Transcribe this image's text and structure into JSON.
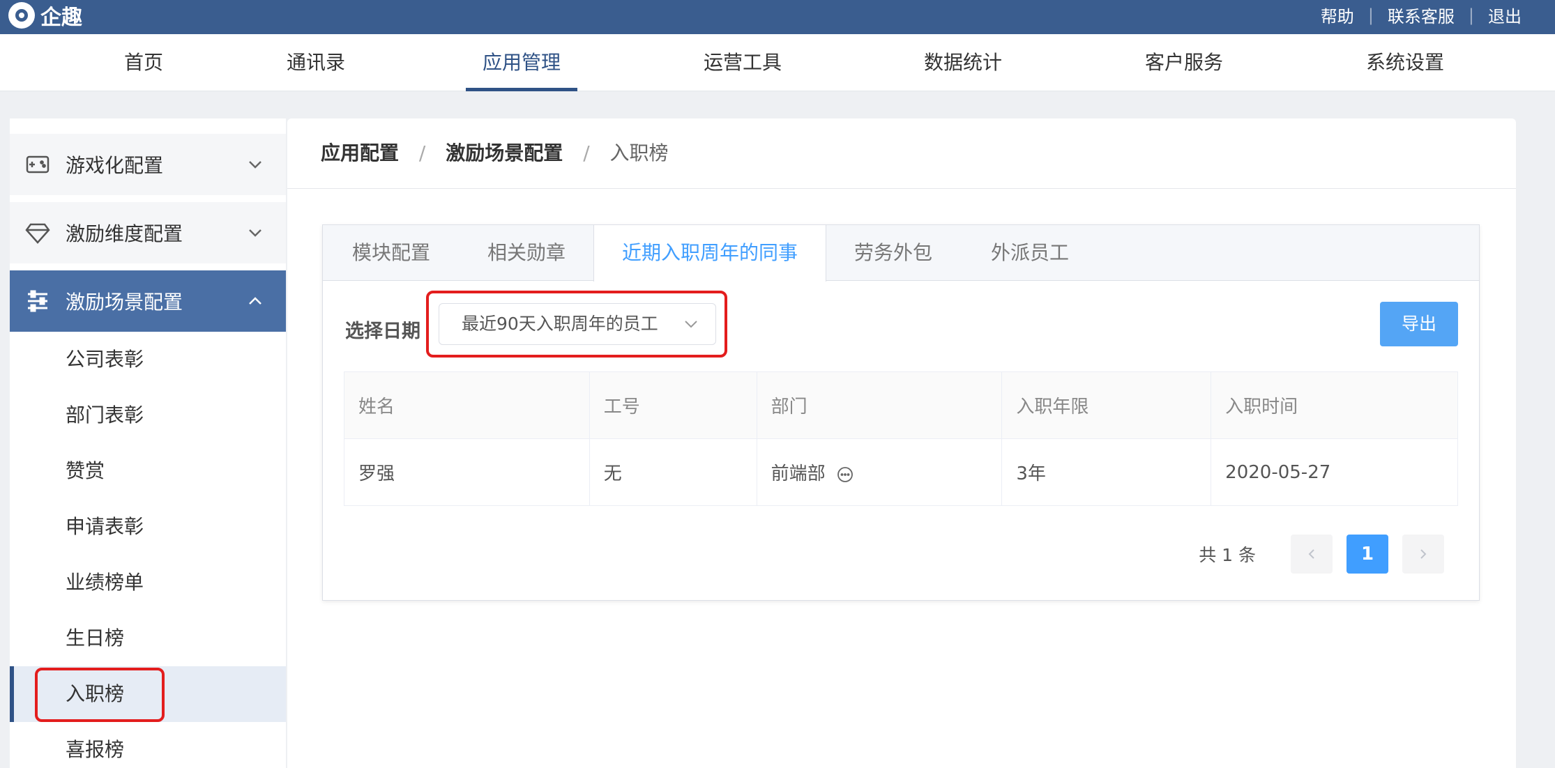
{
  "topbar": {
    "logo_text": "企趣",
    "links": [
      "帮助",
      "联系客服",
      "退出"
    ]
  },
  "nav": {
    "items": [
      "首页",
      "通讯录",
      "应用管理",
      "运营工具",
      "数据统计",
      "客户服务",
      "系统设置"
    ],
    "active": "应用管理"
  },
  "sidebar": {
    "groups": [
      {
        "label": "游戏化配置",
        "icon": "gamepad-icon"
      },
      {
        "label": "激励维度配置",
        "icon": "diamond-icon"
      },
      {
        "label": "激励场景配置",
        "icon": "sliders-icon"
      }
    ],
    "sub_items": [
      "公司表彰",
      "部门表彰",
      "赞赏",
      "申请表彰",
      "业绩榜单",
      "生日榜",
      "入职榜",
      "喜报榜"
    ],
    "active_sub": "入职榜"
  },
  "breadcrumb": {
    "items": [
      "应用配置",
      "激励场景配置",
      "入职榜"
    ]
  },
  "tabs": {
    "items": [
      "模块配置",
      "相关勋章",
      "近期入职周年的同事",
      "劳务外包",
      "外派员工"
    ],
    "active": "近期入职周年的同事"
  },
  "filter": {
    "label": "选择日期",
    "selected": "最近90天入职周年的员工"
  },
  "export_label": "导出",
  "table": {
    "headers": [
      "姓名",
      "工号",
      "部门",
      "入职年限",
      "入职时间"
    ],
    "rows": [
      {
        "name": "罗强",
        "id": "无",
        "dept": "前端部",
        "years": "3年",
        "date": "2020-05-27"
      }
    ]
  },
  "pagination": {
    "total": "共 1 条",
    "current": "1"
  },
  "colors": {
    "topbar": "#3a5d8f",
    "accent": "#409eff",
    "highlight": "#e31d1d"
  }
}
